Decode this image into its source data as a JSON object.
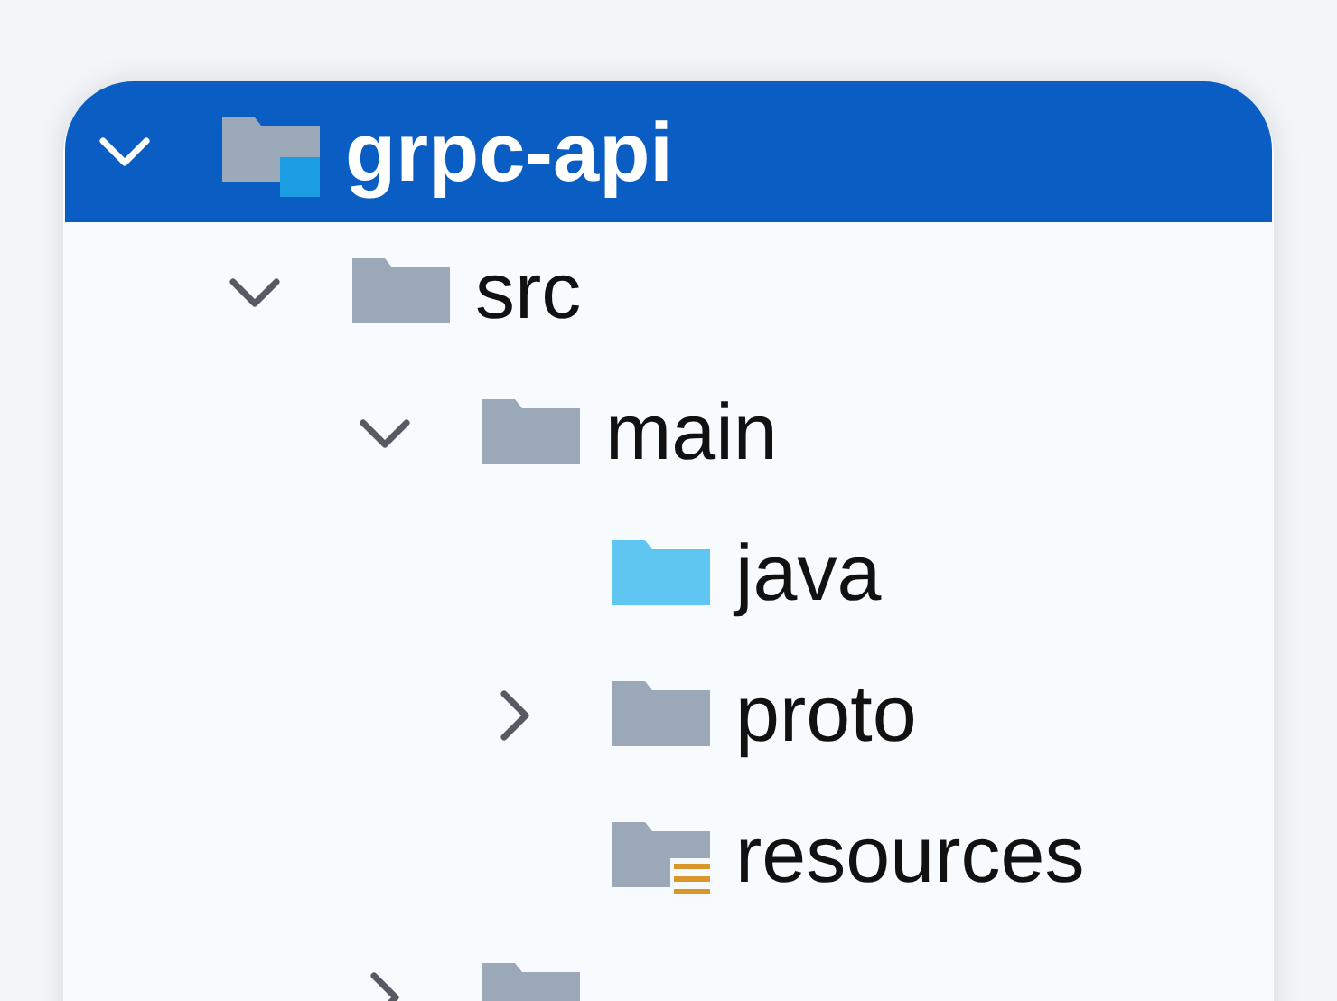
{
  "tree": [
    {
      "label": "grpc-api",
      "kind": "module",
      "expanded": true,
      "selected": true,
      "children": [
        {
          "label": "src",
          "kind": "folder",
          "expanded": true,
          "selected": false,
          "children": [
            {
              "label": "main",
              "kind": "folder",
              "expanded": true,
              "selected": false,
              "children": [
                {
                  "label": "java",
                  "kind": "source",
                  "selected": false
                },
                {
                  "label": "proto",
                  "kind": "folder",
                  "expanded": false,
                  "selected": false
                },
                {
                  "label": "resources",
                  "kind": "resources",
                  "selected": false
                }
              ]
            },
            {
              "kind": "folder",
              "expanded": false,
              "selected": false
            }
          ]
        }
      ]
    }
  ]
}
